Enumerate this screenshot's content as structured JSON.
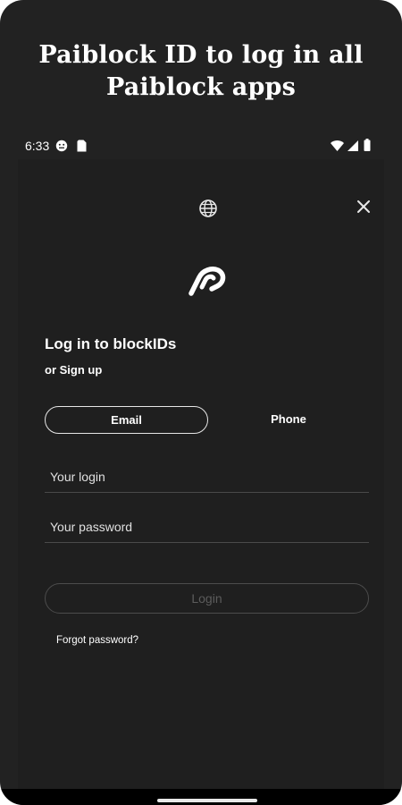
{
  "promo": {
    "line1": "Paiblock ID to log in all",
    "line2": "Paiblock apps"
  },
  "status_bar": {
    "time": "6:33",
    "icons": [
      "face-notification-icon",
      "sim-card-icon",
      "wifi-icon",
      "cellular-signal-icon",
      "battery-icon"
    ]
  },
  "toolbar": {
    "language_icon": "globe-icon",
    "close_icon": "close-icon"
  },
  "brand": {
    "logo_icon": "paiblock-logo-icon"
  },
  "login": {
    "title": "Log in to blockIDs",
    "signup_link": "or Sign up",
    "tabs": [
      {
        "label": "Email",
        "selected": true
      },
      {
        "label": "Phone",
        "selected": false
      }
    ],
    "login_field": {
      "placeholder": "Your login",
      "value": ""
    },
    "password_field": {
      "placeholder": "Your password",
      "value": ""
    },
    "submit_label": "Login",
    "forgot_link": "Forgot password?"
  },
  "colors": {
    "background": "#1f1f1f",
    "text": "#ffffff",
    "disabled": "#5c5c5c",
    "divider": "#4a4a4a"
  }
}
